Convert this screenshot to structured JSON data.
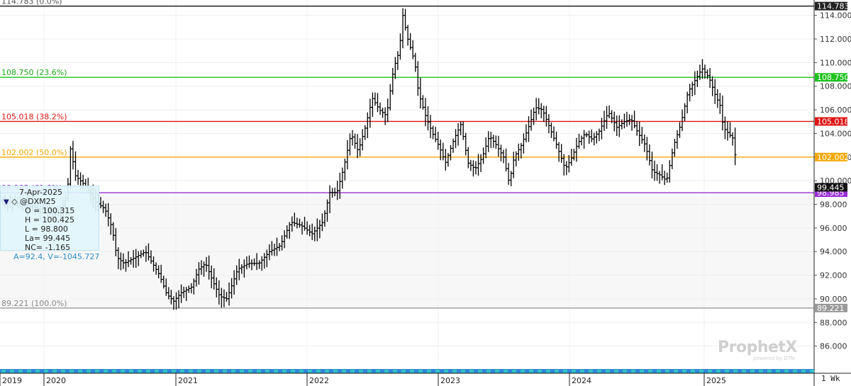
{
  "chart_data": {
    "type": "ohlc",
    "symbol": "@DXM25",
    "period": "1 Wk",
    "y_axis": {
      "min": 84.0,
      "max": 115.3,
      "ticks": [
        "86.000",
        "88.000",
        "90.000",
        "92.000",
        "94.000",
        "96.000",
        "98.000",
        "100.000",
        "102.000",
        "104.000",
        "106.000",
        "108.000",
        "110.000",
        "112.000",
        "114.000"
      ]
    },
    "x_axis": {
      "labels": [
        {
          "text": "2019",
          "t": 0.0
        },
        {
          "text": "2020",
          "t": 62
        },
        {
          "text": "2021",
          "t": 248
        },
        {
          "text": "2022",
          "t": 433
        },
        {
          "text": "2023",
          "t": 618
        },
        {
          "text": "2024",
          "t": 803
        },
        {
          "text": "2025",
          "t": 993
        }
      ]
    },
    "fib_levels": [
      {
        "left_label": "114.783 (0.0%)",
        "value": 114.783,
        "tag": "114.783",
        "line": "#222222",
        "tagbg": "#222222",
        "tagfg": "#ffffff",
        "labelcolor": "#555555"
      },
      {
        "left_label": "108.750 (23.6%)",
        "value": 108.75,
        "tag": "108.750",
        "line": "#1fc21f",
        "tagbg": "#1fc21f",
        "tagfg": "#ffffff",
        "labelcolor": "#1aa81a"
      },
      {
        "left_label": "105.018 (38.2%)",
        "value": 105.018,
        "tag": "105.018",
        "line": "#e01414",
        "tagbg": "#e01414",
        "tagfg": "#ffffff",
        "labelcolor": "#e01414"
      },
      {
        "left_label": "102.002 (50.0%)",
        "value": 102.002,
        "tag": "102.002",
        "line": "#f5a800",
        "tagbg": "#f5a800",
        "tagfg": "#ffffff",
        "labelcolor": "#f5a800"
      },
      {
        "left_label": "98.985 (61.8%)",
        "value": 98.985,
        "tag": "98.985",
        "line": "#9a2fd6",
        "tagbg": "#9a2fd6",
        "tagfg": "#ffffff",
        "labelcolor": "#9a2fd6"
      },
      {
        "left_label": "89.221 (100.0%)",
        "value": 89.221,
        "tag": "89.221",
        "line": "#9a9a9a",
        "tagbg": "#9a9a9a",
        "tagfg": "#ffffff",
        "labelcolor": "#888888"
      }
    ],
    "last_price_tag": "99.445",
    "anchors": [
      [
        0,
        98.3
      ],
      [
        30,
        98.0
      ],
      [
        55,
        97.6
      ],
      [
        70,
        97.5
      ],
      [
        85,
        97.2
      ],
      [
        95,
        99.0
      ],
      [
        100,
        103.2
      ],
      [
        105,
        100.5
      ],
      [
        120,
        99.6
      ],
      [
        135,
        98.2
      ],
      [
        148,
        97.6
      ],
      [
        158,
        96.0
      ],
      [
        165,
        93.5
      ],
      [
        175,
        93.0
      ],
      [
        190,
        93.5
      ],
      [
        205,
        94.0
      ],
      [
        215,
        93.0
      ],
      [
        225,
        92.0
      ],
      [
        235,
        90.4
      ],
      [
        245,
        89.8
      ],
      [
        255,
        90.5
      ],
      [
        270,
        91.0
      ],
      [
        280,
        92.5
      ],
      [
        290,
        93.0
      ],
      [
        300,
        91.5
      ],
      [
        310,
        90.2
      ],
      [
        320,
        90.0
      ],
      [
        335,
        92.5
      ],
      [
        350,
        93.0
      ],
      [
        365,
        93.0
      ],
      [
        380,
        94.0
      ],
      [
        395,
        94.5
      ],
      [
        410,
        96.5
      ],
      [
        425,
        96.2
      ],
      [
        440,
        95.5
      ],
      [
        455,
        96.5
      ],
      [
        465,
        99.0
      ],
      [
        475,
        99.0
      ],
      [
        485,
        101.2
      ],
      [
        495,
        104.0
      ],
      [
        505,
        102.5
      ],
      [
        515,
        104.5
      ],
      [
        525,
        107.0
      ],
      [
        535,
        106.0
      ],
      [
        545,
        105.5
      ],
      [
        555,
        109.5
      ],
      [
        563,
        111.0
      ],
      [
        568,
        114.0
      ],
      [
        575,
        112.0
      ],
      [
        585,
        110.0
      ],
      [
        590,
        107.5
      ],
      [
        600,
        105.5
      ],
      [
        610,
        104.0
      ],
      [
        620,
        102.8
      ],
      [
        628,
        101.5
      ],
      [
        640,
        103.5
      ],
      [
        650,
        104.8
      ],
      [
        660,
        101.5
      ],
      [
        670,
        101.0
      ],
      [
        680,
        102.0
      ],
      [
        690,
        103.8
      ],
      [
        700,
        103.0
      ],
      [
        710,
        102.0
      ],
      [
        718,
        99.8
      ],
      [
        725,
        102.0
      ],
      [
        735,
        103.0
      ],
      [
        745,
        104.5
      ],
      [
        755,
        106.2
      ],
      [
        765,
        106.0
      ],
      [
        775,
        104.5
      ],
      [
        785,
        103.0
      ],
      [
        797,
        101.0
      ],
      [
        805,
        101.8
      ],
      [
        815,
        103.2
      ],
      [
        825,
        104.0
      ],
      [
        835,
        103.5
      ],
      [
        845,
        104.2
      ],
      [
        858,
        105.8
      ],
      [
        870,
        104.5
      ],
      [
        880,
        105.0
      ],
      [
        890,
        105.2
      ],
      [
        900,
        104.0
      ],
      [
        910,
        103.0
      ],
      [
        920,
        100.8
      ],
      [
        930,
        100.5
      ],
      [
        940,
        100.0
      ],
      [
        950,
        103.0
      ],
      [
        960,
        104.8
      ],
      [
        970,
        107.5
      ],
      [
        980,
        108.5
      ],
      [
        990,
        109.5
      ],
      [
        1000,
        108.7
      ],
      [
        1010,
        107.0
      ],
      [
        1015,
        106.5
      ],
      [
        1020,
        104.5
      ],
      [
        1030,
        103.8
      ],
      [
        1035,
        103.5
      ],
      [
        1040,
        99.445
      ]
    ]
  },
  "info_box": {
    "date": "7-Apr-2025",
    "symbol": "@DXM25",
    "open": "O = 100.315",
    "high": "H = 100.425",
    "low": "L = 98.800",
    "last": "La= 99.445",
    "net_change": "NC= -1.165",
    "av": "A=92.4, V=-1045.727"
  },
  "watermark": {
    "brand": "ProphetX",
    "sub": "powered by DTN"
  },
  "period_label": "1 Wk"
}
